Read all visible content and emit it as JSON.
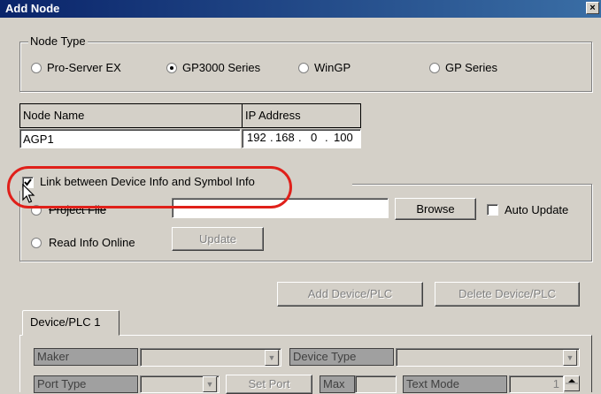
{
  "window": {
    "title": "Add Node",
    "close_glyph": "×"
  },
  "node_type": {
    "legend": "Node Type",
    "options": [
      {
        "label": "Pro-Server EX",
        "selected": false
      },
      {
        "label": "GP3000 Series",
        "selected": true
      },
      {
        "label": "WinGP",
        "selected": false
      },
      {
        "label": "GP Series",
        "selected": false
      }
    ]
  },
  "node_table": {
    "name_header": "Node Name",
    "ip_header": "IP Address",
    "name_value": "AGP1",
    "ip_octets": [
      "192",
      "168",
      "0",
      "100"
    ]
  },
  "link": {
    "label": "Link between Device Info and Symbol Info",
    "checked": true,
    "project_file_label": "Project File",
    "project_file_value": "",
    "browse_label": "Browse",
    "auto_update_label": "Auto Update",
    "read_online_label": "Read Info Online",
    "update_label": "Update"
  },
  "actions": {
    "add_device_label": "Add Device/PLC",
    "delete_device_label": "Delete Device/PLC"
  },
  "device_tab": {
    "tab_label": "Device/PLC 1",
    "maker_label": "Maker",
    "device_type_label": "Device Type",
    "port_type_label": "Port Type",
    "set_port_label": "Set Port",
    "max_label": "Max",
    "text_mode_label": "Text Mode",
    "text_mode_value": "1"
  },
  "colors": {
    "titlebar": "#0a246a",
    "highlight_ring": "#e0201a"
  }
}
